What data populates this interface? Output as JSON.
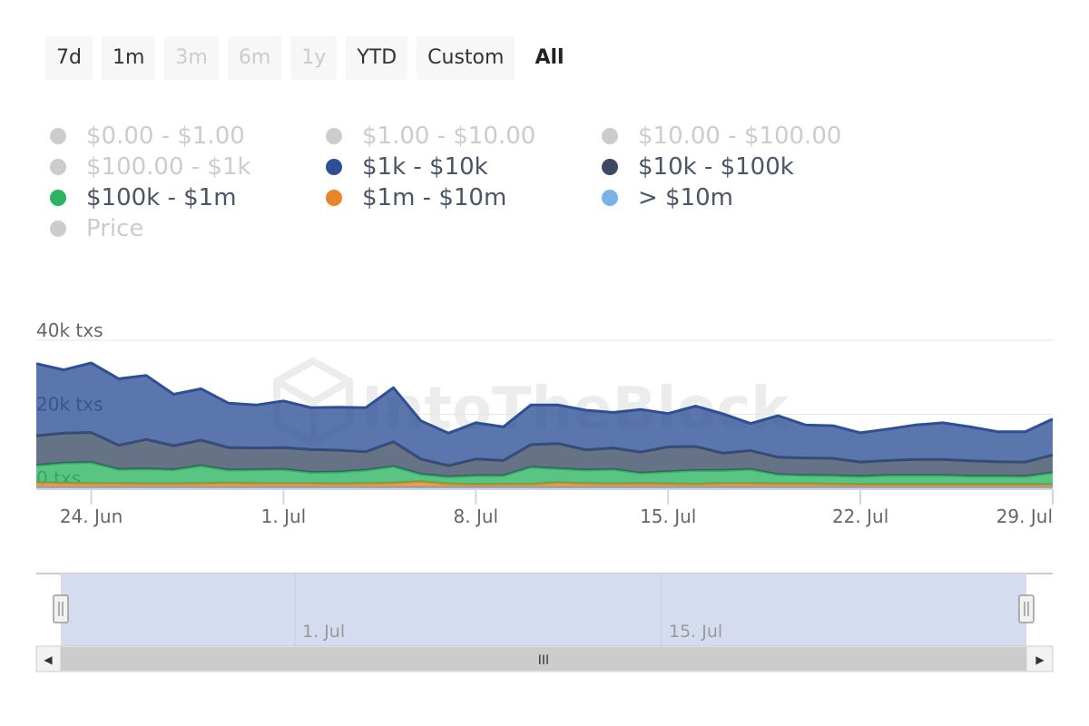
{
  "range_selector": {
    "buttons": [
      {
        "label": "7d",
        "state": "normal"
      },
      {
        "label": "1m",
        "state": "normal"
      },
      {
        "label": "3m",
        "state": "disabled"
      },
      {
        "label": "6m",
        "state": "disabled"
      },
      {
        "label": "1y",
        "state": "disabled"
      },
      {
        "label": "YTD",
        "state": "normal"
      },
      {
        "label": "Custom",
        "state": "normal"
      },
      {
        "label": "All",
        "state": "active"
      }
    ]
  },
  "legend": [
    {
      "label": "$0.00 - $1.00",
      "color": "#cccccc",
      "visible": false
    },
    {
      "label": "$1.00 - $10.00",
      "color": "#cccccc",
      "visible": false
    },
    {
      "label": "$10.00 - $100.00",
      "color": "#cccccc",
      "visible": false
    },
    {
      "label": "$100.00 - $1k",
      "color": "#cccccc",
      "visible": false
    },
    {
      "label": "$1k - $10k",
      "color": "#2c4f96",
      "visible": true
    },
    {
      "label": "$10k - $100k",
      "color": "#3b4a63",
      "visible": true
    },
    {
      "label": "$100k - $1m",
      "color": "#2bb35f",
      "visible": true
    },
    {
      "label": "$1m - $10m",
      "color": "#e8852a",
      "visible": true
    },
    {
      "label": "> $10m",
      "color": "#7ab4e6",
      "visible": true
    },
    {
      "label": "Price",
      "color": "#cccccc",
      "visible": false
    }
  ],
  "watermark": "IntoTheBlock",
  "chart_data": {
    "type": "area",
    "stacked": true,
    "yaxis": {
      "ticks": [
        "0 txs",
        "20k txs",
        "40k txs"
      ],
      "tick_values": [
        0,
        20000,
        40000
      ],
      "ylim": [
        0,
        40000
      ]
    },
    "xaxis": {
      "ticks": [
        "24. Jun",
        "1. Jul",
        "8. Jul",
        "15. Jul",
        "22. Jul",
        "29. Jul"
      ],
      "start": "2024-06-22",
      "end": "2024-07-29"
    },
    "x": [
      "2024-06-22",
      "2024-06-23",
      "2024-06-24",
      "2024-06-25",
      "2024-06-26",
      "2024-06-27",
      "2024-06-28",
      "2024-06-29",
      "2024-06-30",
      "2024-07-01",
      "2024-07-02",
      "2024-07-03",
      "2024-07-04",
      "2024-07-05",
      "2024-07-06",
      "2024-07-07",
      "2024-07-08",
      "2024-07-09",
      "2024-07-10",
      "2024-07-11",
      "2024-07-12",
      "2024-07-13",
      "2024-07-14",
      "2024-07-15",
      "2024-07-16",
      "2024-07-17",
      "2024-07-18",
      "2024-07-19",
      "2024-07-20",
      "2024-07-21",
      "2024-07-22",
      "2024-07-23",
      "2024-07-24",
      "2024-07-25",
      "2024-07-26",
      "2024-07-27",
      "2024-07-28",
      "2024-07-29"
    ],
    "series": [
      {
        "name": "> $10m",
        "color": "#7ab4e6",
        "values": [
          300,
          300,
          300,
          300,
          300,
          300,
          300,
          300,
          300,
          300,
          300,
          300,
          300,
          300,
          300,
          300,
          300,
          300,
          300,
          300,
          300,
          300,
          300,
          300,
          300,
          300,
          300,
          300,
          300,
          300,
          300,
          300,
          300,
          300,
          300,
          300,
          300,
          300
        ]
      },
      {
        "name": "$1m - $10m",
        "color": "#e8852a",
        "values": [
          1200,
          1100,
          1000,
          1000,
          900,
          900,
          1000,
          1100,
          1000,
          1000,
          1000,
          900,
          1000,
          1100,
          1500,
          900,
          700,
          800,
          800,
          1200,
          1000,
          900,
          1000,
          900,
          800,
          1000,
          1000,
          900,
          900,
          800,
          700,
          700,
          700,
          700,
          700,
          700,
          700,
          700
        ]
      },
      {
        "name": "$100k - $1m",
        "color": "#2bb35f",
        "values": [
          4700,
          5400,
          5700,
          3800,
          4000,
          3800,
          4800,
          3500,
          3700,
          3800,
          3000,
          3200,
          3600,
          4500,
          2000,
          1900,
          2400,
          2300,
          4600,
          3800,
          3600,
          3900,
          2800,
          3300,
          3700,
          3500,
          3800,
          2500,
          2300,
          2300,
          2200,
          2500,
          2500,
          2500,
          2300,
          2300,
          2200,
          3200
        ]
      },
      {
        "name": "$10k - $100k",
        "color": "#3b4a63",
        "values": [
          8000,
          8100,
          8100,
          6500,
          8000,
          6500,
          6900,
          6100,
          5900,
          5900,
          6200,
          5900,
          5000,
          6700,
          4100,
          3000,
          4500,
          4100,
          6100,
          6800,
          5500,
          5800,
          5700,
          6700,
          6500,
          4700,
          5100,
          4700,
          4700,
          4700,
          3900,
          4000,
          4300,
          4300,
          4100,
          3900,
          3900,
          4800
        ]
      },
      {
        "name": "$1k - $10k",
        "color": "#2c4f96",
        "values": [
          19500,
          17100,
          18800,
          18000,
          17300,
          13900,
          13900,
          12000,
          11600,
          12600,
          11300,
          11600,
          11900,
          14600,
          10300,
          8800,
          9800,
          9100,
          10700,
          10400,
          10700,
          9600,
          11500,
          9000,
          10900,
          10600,
          7300,
          11200,
          8900,
          8800,
          7900,
          8500,
          9300,
          9900,
          9200,
          8100,
          8200,
          9700
        ]
      }
    ]
  },
  "navigator": {
    "ticks": [
      "1. Jul",
      "15. Jul"
    ],
    "grip_label": "III",
    "left_arrow": "◀",
    "right_arrow": "▶"
  }
}
